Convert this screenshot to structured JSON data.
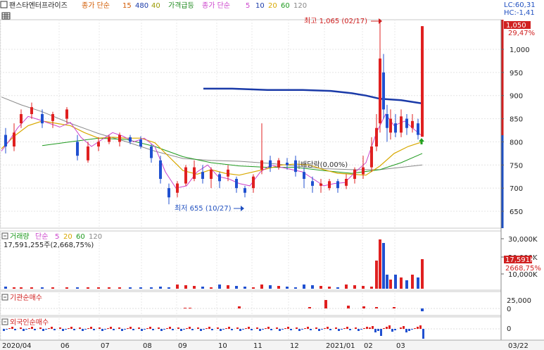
{
  "header": {
    "stock_name": "팬스타엔터프라이즈",
    "ma_label": "종가 단순",
    "ma_periods": [
      "15",
      "480",
      "40"
    ],
    "ma_colors": [
      "#d25a00",
      "#1a3aa8",
      "#9a9a00"
    ],
    "surge_label": "가격급등",
    "ma2_label": "종가 단순",
    "ma2_periods": [
      "5",
      "10",
      "20",
      "60",
      "120"
    ],
    "ma2_colors": [
      "#cc44cc",
      "#1a3aa8",
      "#d8a800",
      "#1f9a1f",
      "#888888"
    ],
    "lc": "LC:60,31",
    "hc": "HC:-1,41"
  },
  "price_panel": {
    "high_annot": "최고 1,065 (02/17)",
    "low_annot": "최저 655 (10/27)",
    "dividend_annot": "배당락(0,00%)",
    "price_tag": "1,050",
    "pct_tag": "29,47%"
  },
  "volume_panel": {
    "title": "거래량",
    "ma_label": "단순",
    "ma_periods": [
      "5",
      "20",
      "60",
      "120"
    ],
    "ma_colors": [
      "#cc44cc",
      "#d8a800",
      "#1f9a1f",
      "#888888"
    ],
    "summary": "17,591,255주(2,668,75%)",
    "vol_tag": "17,591K",
    "vol_pct_tag": "2668,75%"
  },
  "inst_panel": {
    "title": "기관순매수"
  },
  "foreign_panel": {
    "title": "외국인순매수"
  },
  "chart_data": {
    "type": "candlestick",
    "price_axis": {
      "ticks": [
        1000,
        950,
        900,
        850,
        800,
        750,
        700,
        650
      ],
      "tick_labels": [
        "1,000",
        "950",
        "900",
        "850",
        "800",
        "750",
        "700",
        "650"
      ],
      "ylim": [
        605,
        1075
      ]
    },
    "volume_axis": {
      "tick_labels": [
        "30,000K",
        "20,000K",
        "10,000K"
      ]
    },
    "inst_axis": {
      "tick_labels": [
        "25,000",
        "0"
      ]
    },
    "foreign_axis": {
      "tick_labels": [
        "0"
      ]
    },
    "x_labels": [
      "2020/04",
      "06",
      "07",
      "08",
      "09",
      "10",
      "11",
      "12",
      "2021/01",
      "02",
      "03"
    ],
    "x_date": "03/22",
    "series": {
      "ma480": [
        [
          289,
          915
        ],
        [
          330,
          915
        ],
        [
          380,
          912
        ],
        [
          430,
          912
        ],
        [
          470,
          910
        ],
        [
          500,
          905
        ],
        [
          520,
          900
        ],
        [
          540,
          893
        ],
        [
          570,
          890
        ],
        [
          600,
          883
        ]
      ],
      "ma120": [
        [
          2,
          897
        ],
        [
          30,
          880
        ],
        [
          60,
          865
        ],
        [
          100,
          840
        ],
        [
          140,
          818
        ],
        [
          180,
          800
        ],
        [
          220,
          780
        ],
        [
          260,
          764
        ],
        [
          300,
          760
        ],
        [
          340,
          758
        ],
        [
          380,
          754
        ],
        [
          420,
          748
        ],
        [
          460,
          742
        ],
        [
          500,
          740
        ],
        [
          540,
          740
        ],
        [
          570,
          745
        ],
        [
          600,
          750
        ]
      ],
      "ma60": [
        [
          60,
          792
        ],
        [
          100,
          800
        ],
        [
          140,
          808
        ],
        [
          180,
          805
        ],
        [
          220,
          790
        ],
        [
          260,
          768
        ],
        [
          300,
          755
        ],
        [
          340,
          748
        ],
        [
          380,
          745
        ],
        [
          420,
          745
        ],
        [
          460,
          738
        ],
        [
          500,
          732
        ],
        [
          540,
          740
        ],
        [
          570,
          755
        ],
        [
          600,
          775
        ]
      ],
      "ma20": [
        [
          2,
          785
        ],
        [
          20,
          812
        ],
        [
          40,
          835
        ],
        [
          60,
          845
        ],
        [
          80,
          840
        ],
        [
          100,
          835
        ],
        [
          120,
          820
        ],
        [
          140,
          808
        ],
        [
          160,
          810
        ],
        [
          180,
          808
        ],
        [
          200,
          808
        ],
        [
          220,
          798
        ],
        [
          240,
          768
        ],
        [
          260,
          738
        ],
        [
          280,
          730
        ],
        [
          300,
          740
        ],
        [
          320,
          732
        ],
        [
          340,
          728
        ],
        [
          360,
          735
        ],
        [
          380,
          742
        ],
        [
          400,
          750
        ],
        [
          420,
          752
        ],
        [
          440,
          750
        ],
        [
          460,
          740
        ],
        [
          480,
          732
        ],
        [
          500,
          730
        ],
        [
          520,
          728
        ],
        [
          540,
          748
        ],
        [
          560,
          775
        ],
        [
          580,
          790
        ],
        [
          600,
          800
        ]
      ],
      "ma5": [
        [
          2,
          780
        ],
        [
          12,
          800
        ],
        [
          25,
          830
        ],
        [
          40,
          855
        ],
        [
          55,
          848
        ],
        [
          70,
          840
        ],
        [
          85,
          832
        ],
        [
          100,
          842
        ],
        [
          115,
          810
        ],
        [
          130,
          790
        ],
        [
          145,
          805
        ],
        [
          160,
          820
        ],
        [
          175,
          812
        ],
        [
          190,
          800
        ],
        [
          205,
          808
        ],
        [
          220,
          790
        ],
        [
          235,
          735
        ],
        [
          250,
          700
        ],
        [
          265,
          705
        ],
        [
          280,
          735
        ],
        [
          295,
          750
        ],
        [
          310,
          725
        ],
        [
          325,
          720
        ],
        [
          340,
          710
        ],
        [
          355,
          705
        ],
        [
          370,
          735
        ],
        [
          385,
          750
        ],
        [
          400,
          745
        ],
        [
          415,
          740
        ],
        [
          430,
          735
        ],
        [
          445,
          720
        ],
        [
          460,
          705
        ],
        [
          475,
          710
        ],
        [
          490,
          712
        ],
        [
          505,
          735
        ],
        [
          520,
          755
        ],
        [
          535,
          820
        ],
        [
          548,
          860
        ],
        [
          560,
          835
        ],
        [
          575,
          845
        ],
        [
          590,
          825
        ],
        [
          598,
          815
        ]
      ],
      "candles_sample": [
        [
          8,
          815,
          790,
          830,
          775
        ],
        [
          20,
          790,
          820,
          840,
          780
        ],
        [
          30,
          840,
          860,
          870,
          830
        ],
        [
          45,
          860,
          875,
          885,
          850
        ],
        [
          60,
          860,
          840,
          870,
          830
        ],
        [
          75,
          845,
          860,
          865,
          830
        ],
        [
          95,
          850,
          870,
          875,
          840
        ],
        [
          110,
          800,
          770,
          815,
          760
        ],
        [
          125,
          760,
          790,
          800,
          755
        ],
        [
          140,
          790,
          800,
          810,
          780
        ],
        [
          155,
          800,
          810,
          815,
          795
        ],
        [
          170,
          800,
          815,
          820,
          790
        ],
        [
          185,
          810,
          800,
          815,
          795
        ],
        [
          200,
          805,
          790,
          812,
          785
        ],
        [
          215,
          790,
          765,
          795,
          755
        ],
        [
          228,
          760,
          720,
          770,
          710
        ],
        [
          240,
          700,
          680,
          710,
          665
        ],
        [
          252,
          690,
          710,
          715,
          680
        ],
        [
          264,
          710,
          745,
          750,
          705
        ],
        [
          276,
          720,
          745,
          760,
          715
        ],
        [
          288,
          735,
          720,
          750,
          710
        ],
        [
          300,
          720,
          740,
          745,
          700
        ],
        [
          312,
          730,
          715,
          735,
          700
        ],
        [
          324,
          725,
          740,
          750,
          715
        ],
        [
          336,
          720,
          700,
          725,
          690
        ],
        [
          348,
          700,
          690,
          705,
          680
        ],
        [
          360,
          700,
          725,
          730,
          690
        ],
        [
          372,
          740,
          760,
          840,
          730
        ],
        [
          384,
          760,
          745,
          770,
          735
        ],
        [
          396,
          745,
          760,
          765,
          740
        ],
        [
          408,
          755,
          750,
          765,
          740
        ],
        [
          420,
          760,
          735,
          770,
          725
        ],
        [
          432,
          735,
          720,
          745,
          700
        ],
        [
          444,
          715,
          705,
          725,
          690
        ],
        [
          456,
          705,
          710,
          720,
          690
        ],
        [
          468,
          700,
          715,
          720,
          695
        ],
        [
          480,
          715,
          700,
          720,
          690
        ],
        [
          492,
          705,
          720,
          730,
          698
        ],
        [
          504,
          720,
          740,
          745,
          710
        ],
        [
          516,
          730,
          745,
          770,
          720
        ],
        [
          528,
          745,
          790,
          810,
          735
        ],
        [
          535,
          790,
          830,
          860,
          780
        ],
        [
          540,
          840,
          980,
          1065,
          820
        ],
        [
          545,
          950,
          870,
          990,
          850
        ],
        [
          550,
          860,
          830,
          880,
          800
        ],
        [
          555,
          820,
          850,
          870,
          805
        ],
        [
          562,
          840,
          820,
          860,
          810
        ],
        [
          570,
          820,
          855,
          870,
          810
        ],
        [
          578,
          850,
          830,
          860,
          815
        ],
        [
          586,
          830,
          845,
          860,
          820
        ],
        [
          594,
          840,
          815,
          850,
          805
        ],
        [
          600,
          811,
          1050,
          1050,
          811
        ]
      ]
    }
  }
}
